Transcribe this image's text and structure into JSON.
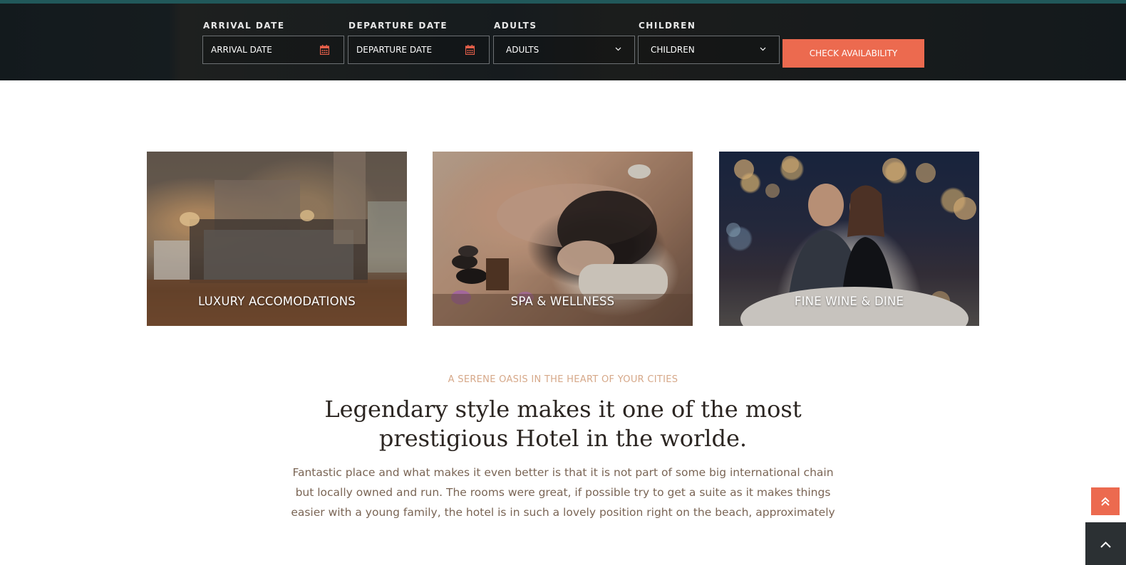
{
  "booking": {
    "arrival": {
      "label": "ARRIVAL DATE",
      "placeholder": "ARRIVAL DATE",
      "icon": "calendar-icon"
    },
    "departure": {
      "label": "DEPARTURE DATE",
      "placeholder": "DEPARTURE DATE",
      "icon": "calendar-icon"
    },
    "adults": {
      "label": "ADULTS",
      "selected": "ADULTS",
      "icon": "chevron-down-icon"
    },
    "children": {
      "label": "CHILDREN",
      "selected": "CHILDREN",
      "icon": "chevron-down-icon"
    },
    "submit_label": "CHECK AVAILABILITY",
    "accent_color": "#ec6a4f"
  },
  "features": [
    {
      "caption": "LUXURY ACCOMODATIONS"
    },
    {
      "caption": "SPA & WELLNESS"
    },
    {
      "caption": "FINE WINE & DINE"
    }
  ],
  "intro": {
    "kicker": "A SERENE OASIS IN THE HEART OF YOUR CITIES",
    "headline_line1": "Legendary style makes it one of the most",
    "headline_line2": "prestigious Hotel in the worlde.",
    "para_line1": "Fantastic place and what makes it even better is that it is not part of some big international chain",
    "para_line2": "but locally owned and run. The rooms were great, if possible try to get a suite as it makes things",
    "para_line3": "easier with a young family, the hotel is in such a lovely position right on the beach, approximately"
  },
  "floating": {
    "top_button_icon": "double-chevron-up-icon",
    "scroll_button_icon": "chevron-up-icon"
  }
}
